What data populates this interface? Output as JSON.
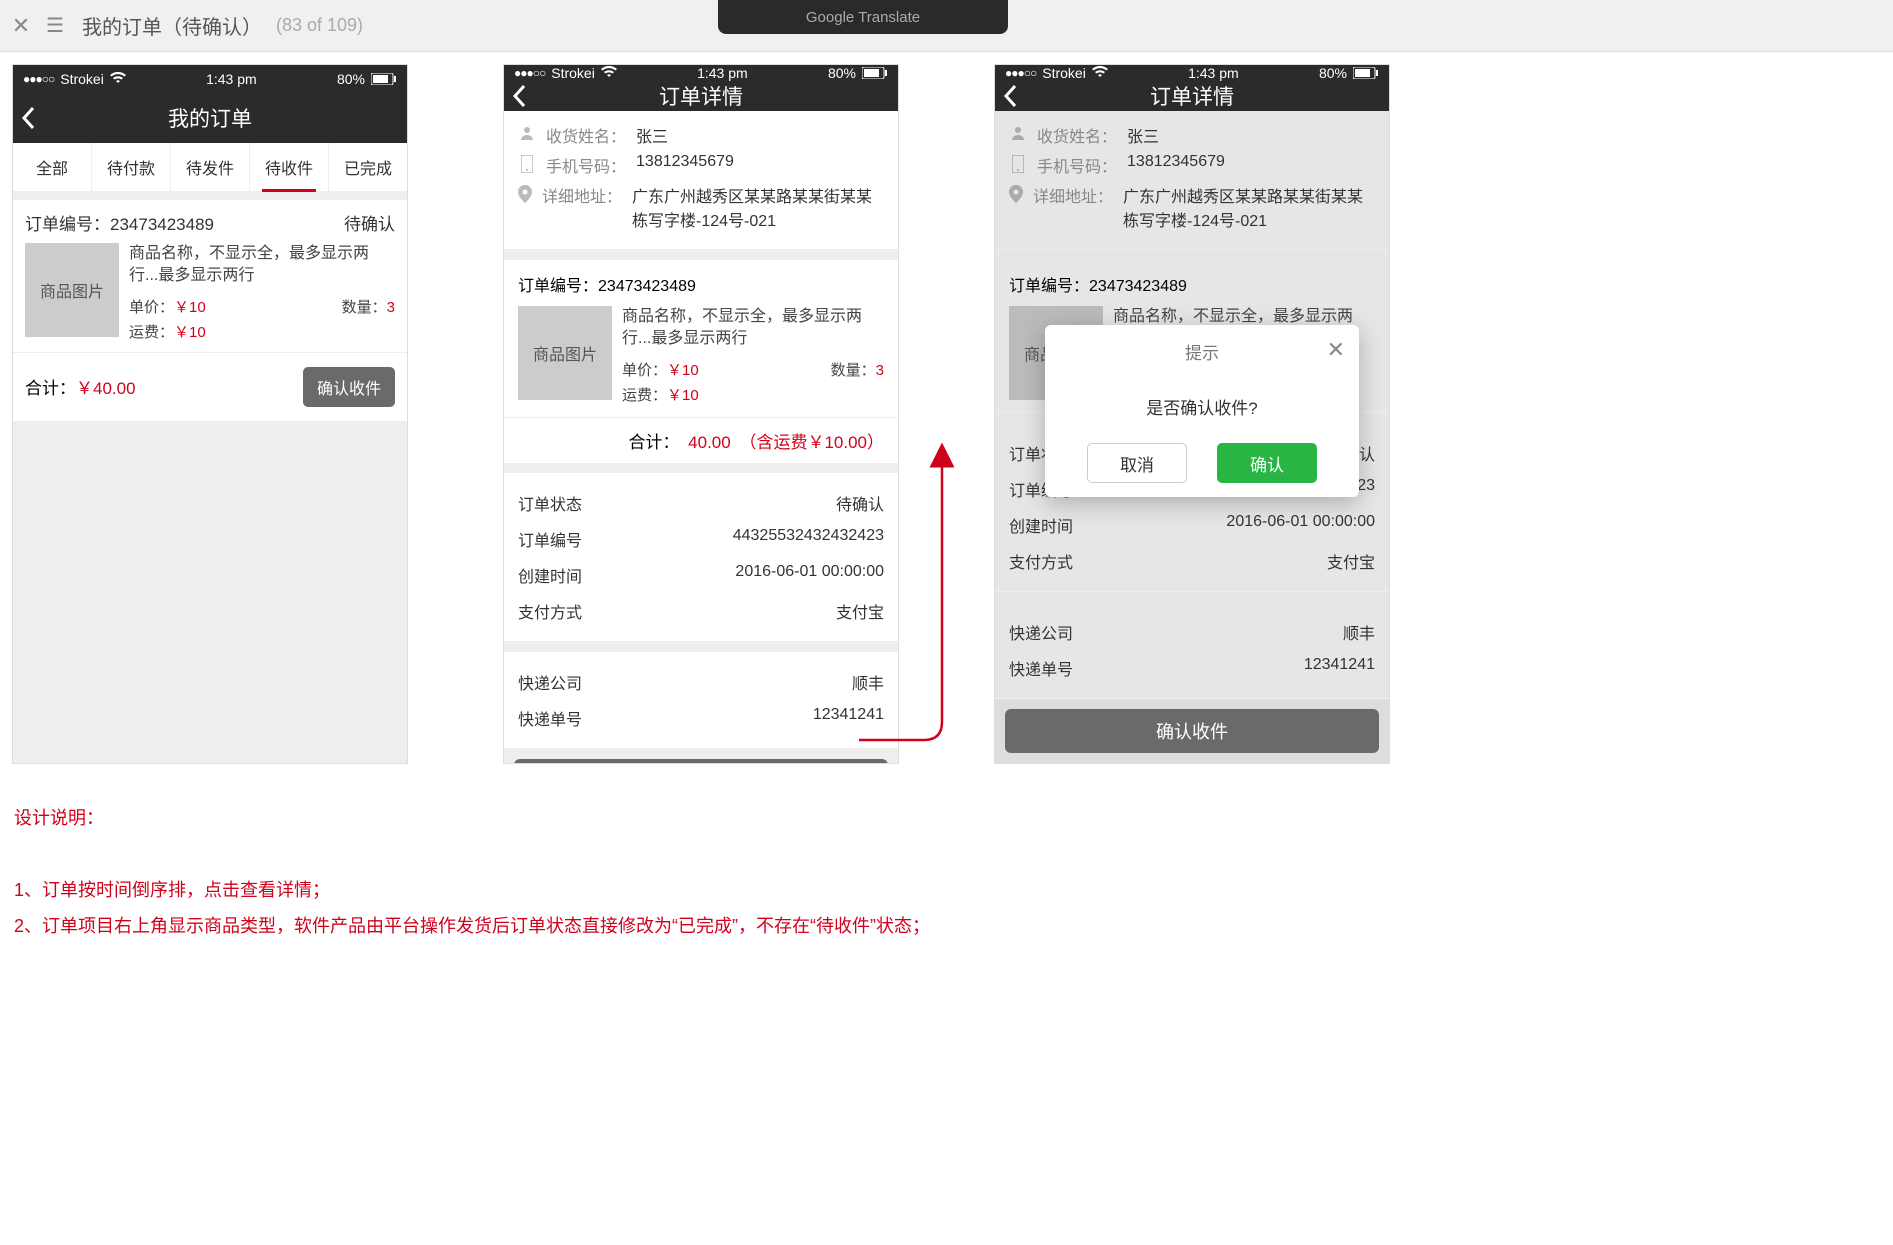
{
  "toolbar": {
    "title": "我的订单（待确认）",
    "count": "(83 of 109)",
    "gt": "Google Translate"
  },
  "statusbar": {
    "carrier": "Strokei",
    "time": "1:43 pm",
    "battery": "80%"
  },
  "tabs": [
    "全部",
    "待付款",
    "待发件",
    "待收件",
    "已完成"
  ],
  "list": {
    "nav_title": "我的订单",
    "order_no_label": "订单编号：",
    "order_no": "23473423489",
    "status": "待确认",
    "thumb": "商品图片",
    "product_name": "商品名称，不显示全，最多显示两行...最多显示两行",
    "price_label": "单价：",
    "price": "￥10",
    "qty_label": "数量：",
    "qty": "3",
    "ship_label": "运费：",
    "ship": "￥10",
    "total_label": "合计：",
    "total": "￥40.00",
    "confirm_btn": "确认收件"
  },
  "detail": {
    "nav_title": "订单详情",
    "recv_name_label": "收货姓名：",
    "recv_name": "张三",
    "phone_label": "手机号码：",
    "phone": "13812345679",
    "addr_label": "详细地址：",
    "addr": "广东广州越秀区某某路某某街某某栋写字楼-124号-021",
    "order_no_label": "订单编号：",
    "order_no": "23473423489",
    "thumb": "商品图片",
    "product_name": "商品名称，不显示全，最多显示两行...最多显示两行",
    "price_label": "单价：",
    "price": "￥10",
    "qty_label": "数量：",
    "qty": "3",
    "ship_label": "运费：",
    "ship": "￥10",
    "total_label": "合计：",
    "total": "40.00",
    "total_ship": "（含运费￥10.00）",
    "status_label": "订单状态",
    "status_value": "待确认",
    "order_no2_label": "订单编号",
    "order_no2_value": "44325532432432423",
    "created_label": "创建时间",
    "created_value": "2016-06-01 00:00:00",
    "pay_label": "支付方式",
    "pay_value": "支付宝",
    "express_co_label": "快递公司",
    "express_co_value": "顺丰",
    "express_no_label": "快递单号",
    "express_no_value": "12341241",
    "confirm_btn": "确认收件"
  },
  "modal": {
    "title": "提示",
    "message": "是否确认收件?",
    "cancel": "取消",
    "ok": "确认"
  },
  "notes": {
    "heading": "设计说明：",
    "l1": "1、订单按时间倒序排，点击查看详情；",
    "l2": "2、订单项目右上角显示商品类型，软件产品由平台操作发货后订单状态直接修改为“已完成”，不存在“待收件”状态；"
  }
}
